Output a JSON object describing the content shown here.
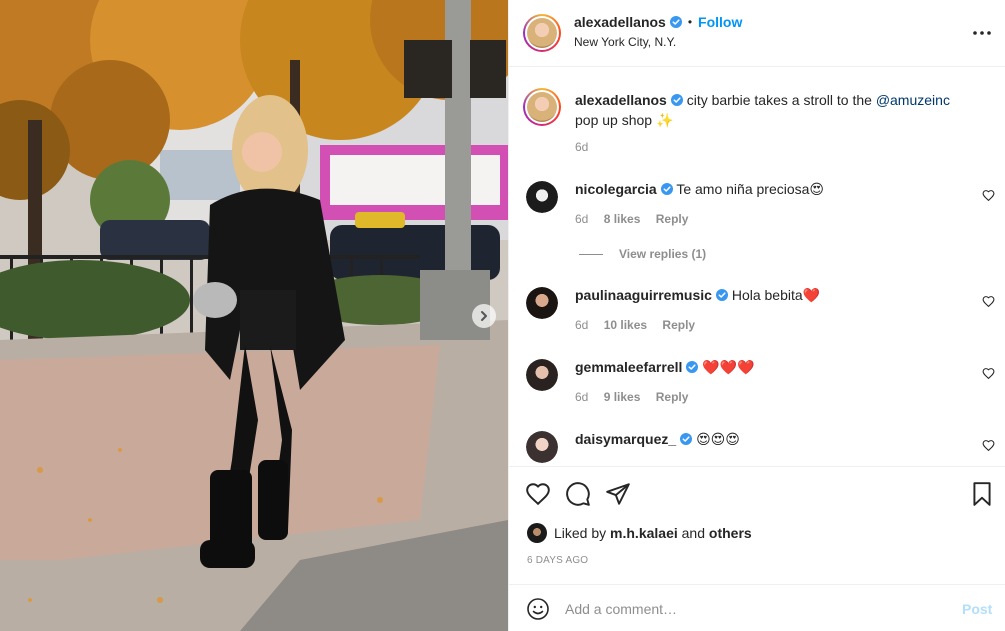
{
  "post": {
    "author": "alexadellanos",
    "follow_label": "Follow",
    "separator": "•",
    "location": "New York City, N.Y.",
    "caption_author": "alexadellanos",
    "caption_text_before": "city barbie takes a stroll to the ",
    "caption_mention": "@amuzeinc",
    "caption_text_after": " pop up shop ✨",
    "caption_age": "6d"
  },
  "comments": [
    {
      "user": "nicolegarcia",
      "text": "Te amo niña preciosa😍",
      "age": "6d",
      "likes": "8 likes",
      "reply": "Reply",
      "verified": true
    },
    {
      "user": "paulinaaguirremusic",
      "text": "Hola bebita❤️",
      "age": "6d",
      "likes": "10 likes",
      "reply": "Reply",
      "verified": true
    },
    {
      "user": "gemmaleefarrell",
      "text": "❤️❤️❤️",
      "age": "6d",
      "likes": "9 likes",
      "reply": "Reply",
      "verified": true
    },
    {
      "user": "daisymarquez_",
      "text": "😍😍😍",
      "verified": true
    }
  ],
  "view_replies": "View replies (1)",
  "likes": {
    "prefix": "Liked by ",
    "user": "m.h.kalaei",
    "middle": " and ",
    "others": "others"
  },
  "date_label": "6 DAYS AGO",
  "composer": {
    "placeholder": "Add a comment…",
    "post_label": "Post"
  },
  "icons": {
    "verified": "verified-badge-icon",
    "more": "more-options-icon",
    "like": "heart-icon",
    "comment": "comment-bubble-icon",
    "share": "paper-plane-icon",
    "save": "bookmark-icon",
    "emoji": "emoji-smiley-icon",
    "next": "chevron-right-icon"
  },
  "colors": {
    "accent": "#0095f6",
    "post_disabled": "#b2dffc",
    "muted": "#8e8e8e",
    "text": "#262626",
    "mention": "#00376b"
  }
}
